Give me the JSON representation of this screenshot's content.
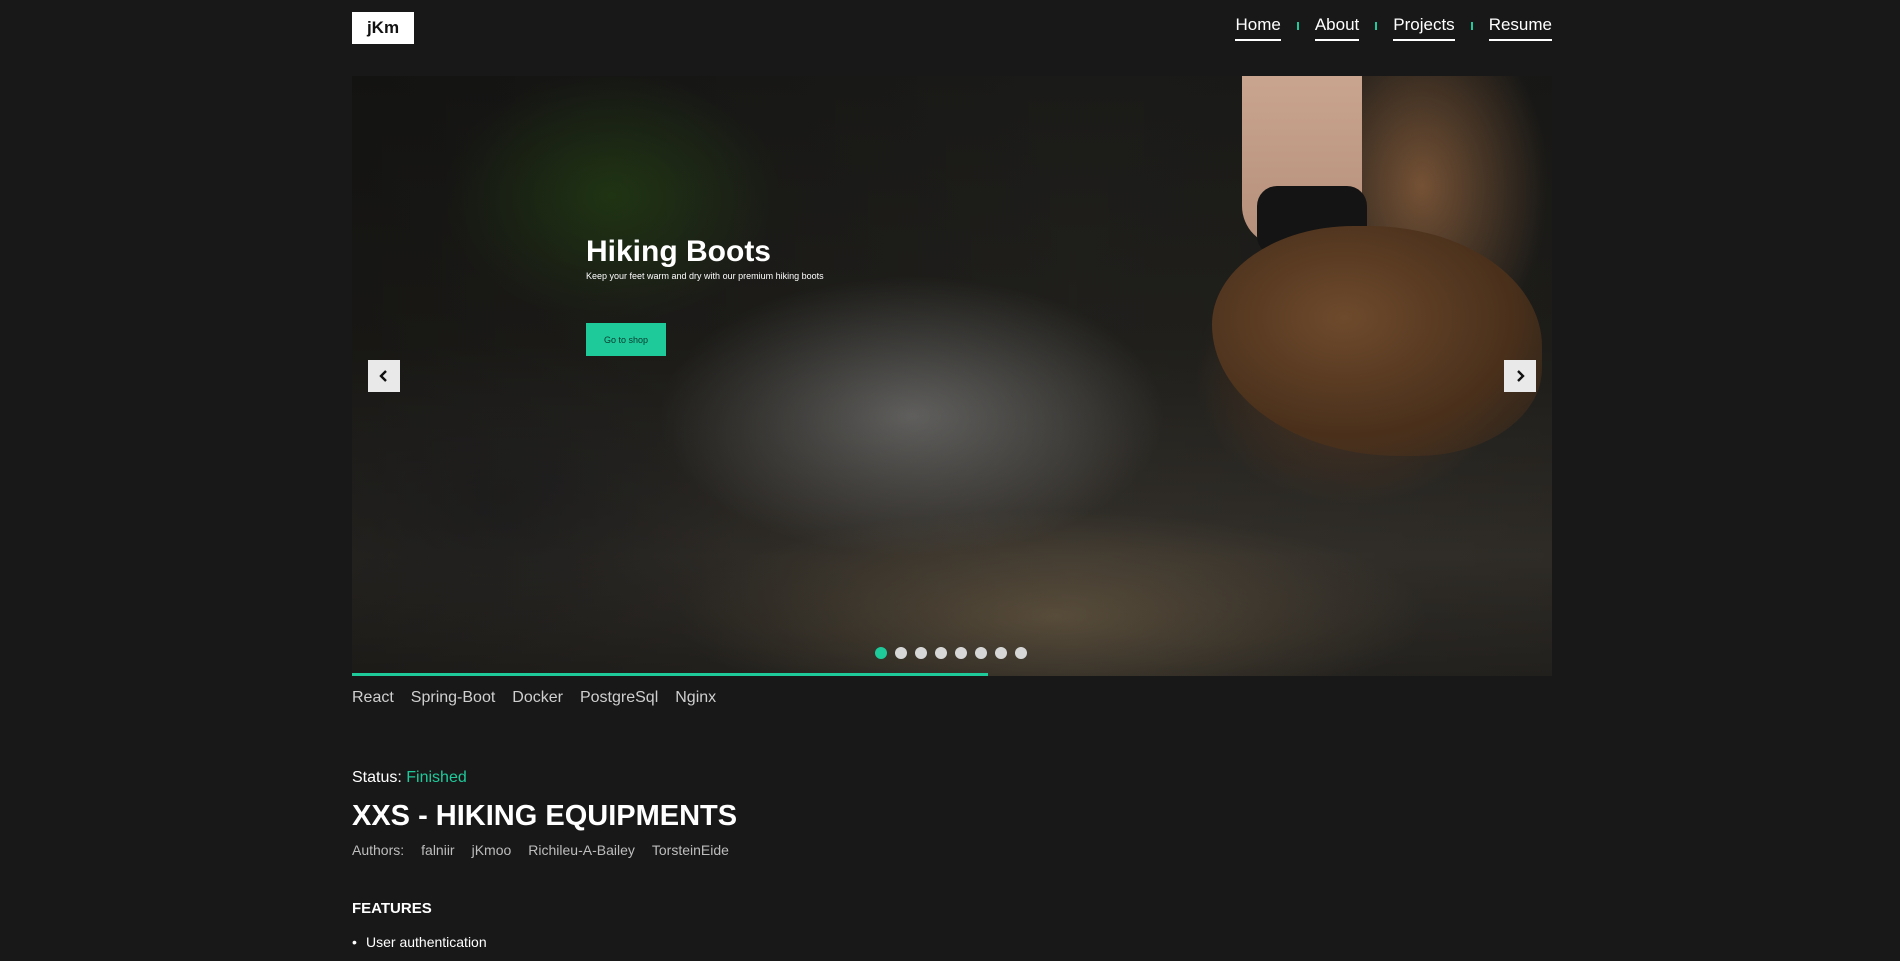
{
  "header": {
    "logo": "jKm",
    "nav": [
      {
        "label": "Home"
      },
      {
        "label": "About"
      },
      {
        "label": "Projects"
      },
      {
        "label": "Resume"
      }
    ]
  },
  "hero": {
    "title": "Hiking Boots",
    "subtitle": "Keep your feet warm and dry with our premium hiking boots",
    "button_label": "Go to shop",
    "slide_count": 8,
    "active_slide": 1,
    "progress": 0.53
  },
  "tags": [
    "React",
    "Spring-Boot",
    "Docker",
    "PostgreSql",
    "Nginx"
  ],
  "status": {
    "label": "Status:",
    "value": "Finished"
  },
  "project_title": "XXS - HIKING EQUIPMENTS",
  "authors": {
    "label": "Authors:",
    "names": [
      "falniir",
      "jKmoo",
      "Richileu-A-Bailey",
      "TorsteinEide"
    ]
  },
  "features": {
    "heading": "FEATURES",
    "items": [
      "User authentication"
    ]
  },
  "colors": {
    "accent": "#1ec99a",
    "background": "#181818"
  }
}
